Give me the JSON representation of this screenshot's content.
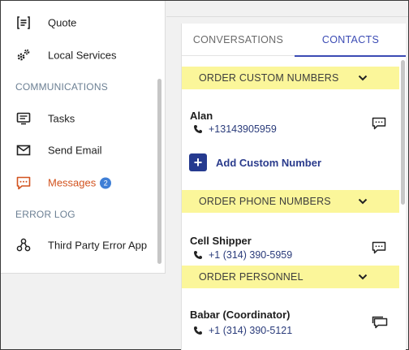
{
  "sidebar": {
    "items_top": [
      {
        "label": "Quote",
        "icon": "quote-icon"
      },
      {
        "label": "Local Services",
        "icon": "gears-icon"
      }
    ],
    "communications_heading": "COMMUNICATIONS",
    "comm_items": [
      {
        "label": "Tasks",
        "icon": "tasks-icon"
      },
      {
        "label": "Send Email",
        "icon": "envelope-icon"
      },
      {
        "label": "Messages",
        "icon": "chat-icon",
        "badge": "2",
        "active": true
      }
    ],
    "error_heading": "ERROR LOG",
    "error_items": [
      {
        "label": "Third Party Error App",
        "icon": "nodes-icon"
      }
    ]
  },
  "tabs": {
    "conversations": "CONVERSATIONS",
    "contacts": "CONTACTS",
    "selected": "CONTACTS"
  },
  "sections": {
    "custom_numbers": {
      "title": "ORDER CUSTOM NUMBERS",
      "contact": {
        "name": "Alan",
        "phone": "+13143905959"
      },
      "add_label": "Add Custom Number"
    },
    "phone_numbers": {
      "title": "ORDER PHONE NUMBERS",
      "contact": {
        "name": "Cell Shipper",
        "phone": "+1 (314) 390-5959"
      }
    },
    "personnel": {
      "title": "ORDER PERSONNEL",
      "contact": {
        "name": "Babar (Coordinator)",
        "phone": "+1 (314) 390-5121"
      }
    }
  },
  "colors": {
    "accent": "#3b4bb4",
    "active_nav": "#d2531f",
    "section_highlight": "#fbf69a",
    "badge": "#3f7fd6",
    "add_button": "#253a8f"
  }
}
